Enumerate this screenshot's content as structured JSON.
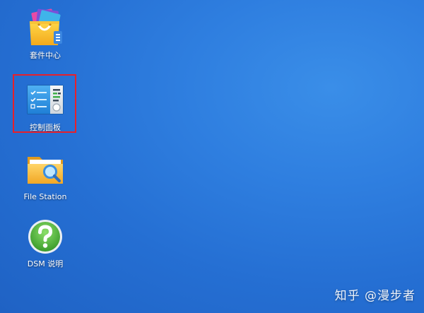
{
  "desktop": {
    "icons": [
      {
        "label": "套件中心",
        "icon": "package-center-icon"
      },
      {
        "label": "控制面板",
        "icon": "control-panel-icon"
      },
      {
        "label": "File Station",
        "icon": "file-station-icon"
      },
      {
        "label": "DSM 说明",
        "icon": "dsm-help-icon"
      }
    ],
    "highlighted": "控制面板"
  },
  "watermark": {
    "text": "知乎 @漫步者"
  },
  "colors": {
    "background": "#2a74d8",
    "highlight_border": "#e8202a",
    "label_text": "#ffffff"
  }
}
